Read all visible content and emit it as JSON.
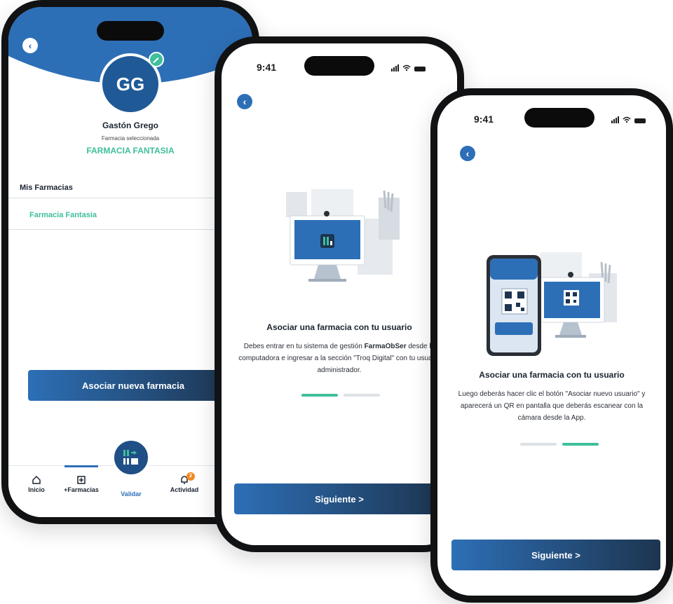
{
  "colors": {
    "primary": "#2d6fb6",
    "primary_dark": "#1d3550",
    "accent": "#3fbf9a",
    "notification": "#f08a24",
    "active_tab": "#2d6fb6"
  },
  "profile_screen": {
    "avatar_initials": "GG",
    "user_name": "Gastón Grego",
    "pharmacy_caption": "Farmacia seleccionada",
    "selected_pharmacy": "FARMACIA FANTASIA",
    "section_title": "Mis Farmacias",
    "pharmacies": [
      {
        "name": "Farmacia Fantasia"
      }
    ],
    "button_label": "Asociar nueva farmacia",
    "nav": {
      "home": "Inicio",
      "add": "+Farmacias",
      "validate": "Validar",
      "activity": "Actividad",
      "activity_badge": "2"
    }
  },
  "onboarding_step1": {
    "time": "9:41",
    "title": "Asociar una farmacia con tu usuario",
    "body_part1": "Debes entrar en tu sistema de gestión ",
    "body_bold": "FarmaObSer",
    "body_part2": " desde la computadora e ingresar a la sección \"Troq Digital\" con tu usuario administrador.",
    "button_label": "Siguiente >",
    "active_step": 1,
    "total_steps": 2
  },
  "onboarding_step2": {
    "time": "9:41",
    "title": "Asociar una farmacia con tu usuario",
    "body": "Luego deberás hacer clic el botón \"Asociar nuevo usuario\" y aparecerá un QR en pantalla que deberás escanear con la cámara desde la App.",
    "button_label": "Siguiente >",
    "active_step": 2,
    "total_steps": 2
  }
}
